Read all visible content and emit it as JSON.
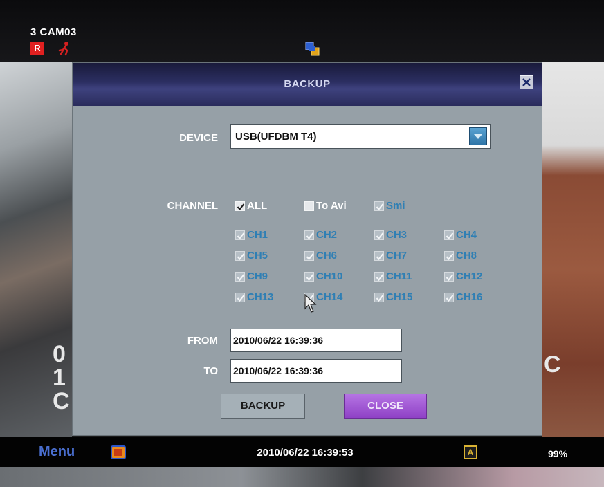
{
  "osd": {
    "camera_label": "3 CAM03",
    "record_badge": "R",
    "motion_icon": "motion-icon",
    "network_icon": "network-icon",
    "ghost_left": "0 1 C",
    "ghost_right": "C"
  },
  "dialog": {
    "title": "BACKUP",
    "close_icon": "close-icon",
    "device": {
      "label": "DEVICE",
      "value": "USB(UFDBM T4)",
      "dropdown_icon": "chevron-down-icon"
    },
    "channel": {
      "label": "CHANNEL",
      "options": [
        {
          "label": "ALL",
          "checked": true
        },
        {
          "label": "To Avi",
          "checked": false
        },
        {
          "label": "Smi",
          "checked": true
        }
      ],
      "channels": [
        {
          "label": "CH1",
          "checked": true
        },
        {
          "label": "CH2",
          "checked": true
        },
        {
          "label": "CH3",
          "checked": true
        },
        {
          "label": "CH4",
          "checked": true
        },
        {
          "label": "CH5",
          "checked": true
        },
        {
          "label": "CH6",
          "checked": true
        },
        {
          "label": "CH7",
          "checked": true
        },
        {
          "label": "CH8",
          "checked": true
        },
        {
          "label": "CH9",
          "checked": true
        },
        {
          "label": "CH10",
          "checked": true
        },
        {
          "label": "CH11",
          "checked": true
        },
        {
          "label": "CH12",
          "checked": true
        },
        {
          "label": "CH13",
          "checked": true
        },
        {
          "label": "CH14",
          "checked": true
        },
        {
          "label": "CH15",
          "checked": true
        },
        {
          "label": "CH16",
          "checked": true
        }
      ]
    },
    "from": {
      "label": "FROM",
      "value": "2010/06/22 16:39:36"
    },
    "to": {
      "label": "TO",
      "value": "2010/06/22 16:39:36"
    },
    "backup_button": "BACKUP",
    "close_button": "CLOSE"
  },
  "status_bar": {
    "menu": "Menu",
    "media_icon": "media-icon",
    "datetime": "2010/06/22 16:39:53",
    "auto_badge": "A",
    "hdd_usage": "99%"
  },
  "colors": {
    "dialog_bg": "#96a0a7",
    "title_bar": "#2c2f62",
    "channel_text": "#2f7fb4",
    "close_button": "#9b4fd0",
    "menu_text": "#4a6fd0"
  }
}
